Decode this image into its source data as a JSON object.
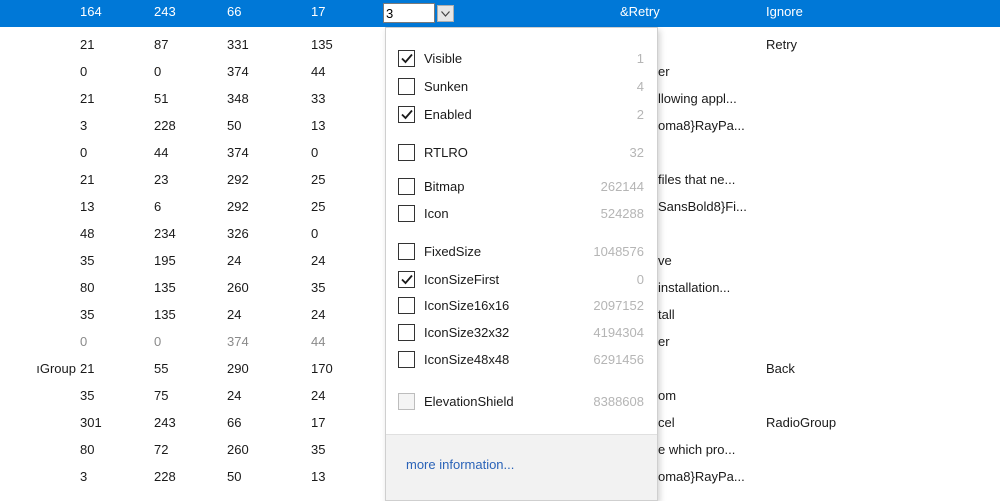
{
  "grid": {
    "rows": [
      {
        "c0": "",
        "c1": "164",
        "c2": "243",
        "c3": "66",
        "c4": "17",
        "c6": "&Retry",
        "c7": "Ignore",
        "selected": true
      },
      {
        "c0": "",
        "c1": "21",
        "c2": "87",
        "c3": "331",
        "c4": "135",
        "c6": "",
        "c7": "Retry"
      },
      {
        "c0": "",
        "c1": "0",
        "c2": "0",
        "c3": "374",
        "c4": "44",
        "c6": "er",
        "c7": ""
      },
      {
        "c0": "",
        "c1": "21",
        "c2": "51",
        "c3": "348",
        "c4": "33",
        "c6": "llowing appl...",
        "c7": ""
      },
      {
        "c0": "",
        "c1": "3",
        "c2": "228",
        "c3": "50",
        "c4": "13",
        "c6": "oma8}RayPa...",
        "c7": ""
      },
      {
        "c0": "",
        "c1": "0",
        "c2": "44",
        "c3": "374",
        "c4": "0",
        "c6": "",
        "c7": ""
      },
      {
        "c0": "",
        "c1": "21",
        "c2": "23",
        "c3": "292",
        "c4": "25",
        "c6": "files that ne...",
        "c7": ""
      },
      {
        "c0": "",
        "c1": "13",
        "c2": "6",
        "c3": "292",
        "c4": "25",
        "c6": "SansBold8}Fi...",
        "c7": ""
      },
      {
        "c0": "",
        "c1": "48",
        "c2": "234",
        "c3": "326",
        "c4": "0",
        "c6": "",
        "c7": ""
      },
      {
        "c0": "",
        "c1": "35",
        "c2": "195",
        "c3": "24",
        "c4": "24",
        "c6": "ve",
        "c7": ""
      },
      {
        "c0": "",
        "c1": "80",
        "c2": "135",
        "c3": "260",
        "c4": "35",
        "c6": "installation...",
        "c7": ""
      },
      {
        "c0": "",
        "c1": "35",
        "c2": "135",
        "c3": "24",
        "c4": "24",
        "c6": "tall",
        "c7": ""
      },
      {
        "c0": "",
        "c1": "0",
        "c2": "0",
        "c3": "374",
        "c4": "44",
        "c6": "er",
        "c7": "",
        "gray": true
      },
      {
        "c0": "ıGroup",
        "c1": "21",
        "c2": "55",
        "c3": "290",
        "c4": "170",
        "c6": "",
        "c7": "Back"
      },
      {
        "c0": "",
        "c1": "35",
        "c2": "75",
        "c3": "24",
        "c4": "24",
        "c6": "om",
        "c7": ""
      },
      {
        "c0": "",
        "c1": "301",
        "c2": "243",
        "c3": "66",
        "c4": "17",
        "c6": "cel",
        "c7": "RadioGroup"
      },
      {
        "c0": "",
        "c1": "80",
        "c2": "72",
        "c3": "260",
        "c4": "35",
        "c6": "e which pro...",
        "c7": ""
      },
      {
        "c0": "",
        "c1": "3",
        "c2": "228",
        "c3": "50",
        "c4": "13",
        "c6": "oma8}RayPa...",
        "c7": ""
      }
    ]
  },
  "editor": {
    "attributes_value": "3",
    "dropdown_icon": "chevron-down-icon"
  },
  "popup": {
    "flags": [
      {
        "label": "Visible",
        "value": "1",
        "checked": true
      },
      {
        "label": "Sunken",
        "value": "4",
        "checked": false
      },
      {
        "label": "Enabled",
        "value": "2",
        "checked": true
      },
      {
        "label": "RTLRO",
        "value": "32",
        "checked": false
      },
      {
        "label": "Bitmap",
        "value": "262144",
        "checked": false
      },
      {
        "label": "Icon",
        "value": "524288",
        "checked": false
      },
      {
        "label": "FixedSize",
        "value": "1048576",
        "checked": false
      },
      {
        "label": "IconSizeFirst",
        "value": "0",
        "checked": true
      },
      {
        "label": "IconSize16x16",
        "value": "2097152",
        "checked": false
      },
      {
        "label": "IconSize32x32",
        "value": "4194304",
        "checked": false
      },
      {
        "label": "IconSize48x48",
        "value": "6291456",
        "checked": false
      },
      {
        "label": "ElevationShield",
        "value": "8388608",
        "checked": false,
        "disabled": true
      }
    ],
    "more_info_link": "more information..."
  },
  "colors": {
    "selection": "#0078d7",
    "link": "#2a63b8",
    "flag_value": "#b5b5b5"
  }
}
